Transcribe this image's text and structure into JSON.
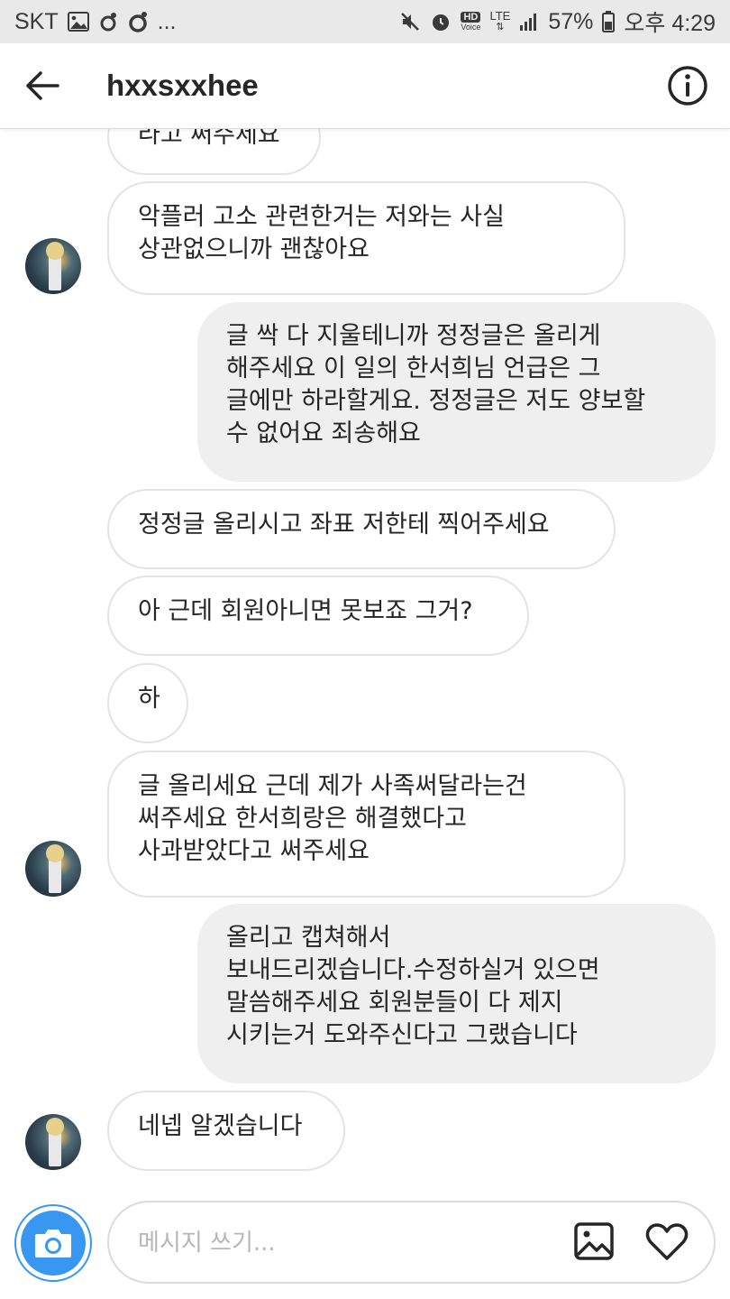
{
  "status_bar": {
    "carrier": "SKT",
    "extra": "...",
    "network": "LTE",
    "hd_voice": "HD",
    "voice": "Voice",
    "battery": "57%",
    "time": "오후 4:29"
  },
  "header": {
    "username": "hxxsxxhee"
  },
  "messages": [
    {
      "from": "them",
      "text": "라고 써주세요"
    },
    {
      "from": "them",
      "text": "악플러 고소 관련한거는 저와는 사실\n상관없으니까 괜찮아요"
    },
    {
      "from": "me",
      "text": "글 싹 다 지울테니까 정정글은 올리게\n해주세요 이 일의 한서희님 언급은 그\n글에만 하라할게요. 정정글은 저도 양보할\n수 없어요 죄송해요"
    },
    {
      "from": "them",
      "text": "정정글 올리시고 좌표 저한테 찍어주세요"
    },
    {
      "from": "them",
      "text": "아 근데 회원아니면 못보죠 그거?"
    },
    {
      "from": "them",
      "text": "하"
    },
    {
      "from": "them",
      "text": "글 올리세요 근데 제가 사족써달라는건\n써주세요 한서희랑은 해결했다고\n사과받았다고 써주세요"
    },
    {
      "from": "me",
      "text": "올리고 캡쳐해서\n보내드리겠습니다.수정하실거 있으면\n말씀해주세요 회원분들이 다 제지\n시키는거 도와주신다고 그랬습니다"
    },
    {
      "from": "them",
      "text": "네넵 알겠습니다"
    }
  ],
  "composer": {
    "placeholder": "메시지 쓰기..."
  },
  "colors": {
    "accent": "#3897f0",
    "outgoing_bubble": "#efefef",
    "incoming_border": "#e3e3e3"
  },
  "icons": {
    "back": "arrow-left-icon",
    "info": "info-icon",
    "camera": "camera-icon",
    "gallery": "image-icon",
    "like": "heart-icon"
  }
}
